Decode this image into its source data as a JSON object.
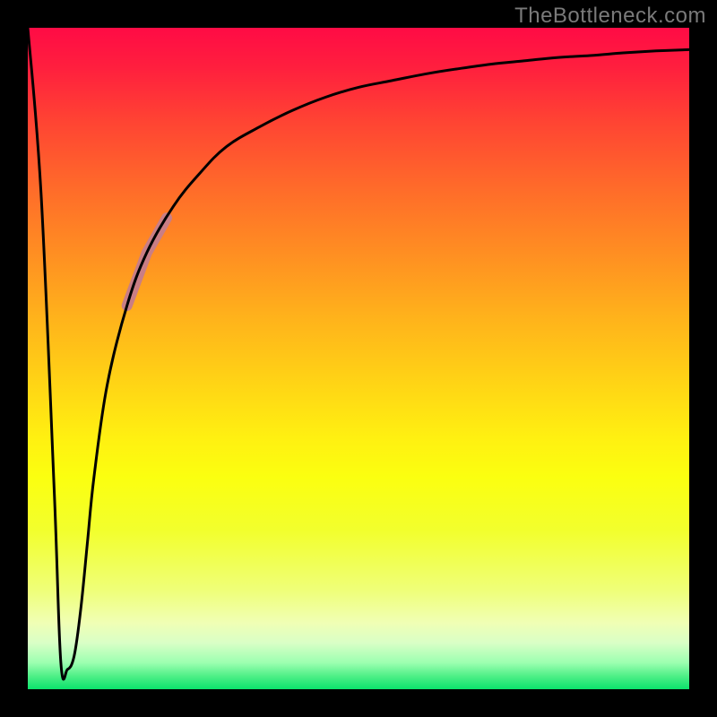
{
  "watermark": "TheBottleneck.com",
  "chart_data": {
    "type": "line",
    "title": "",
    "xlabel": "",
    "ylabel": "",
    "xlim": [
      0,
      100
    ],
    "ylim": [
      0,
      100
    ],
    "grid": false,
    "legend": false,
    "background_gradient": {
      "top_color": "#ff0b45",
      "bottom_color": "#0be36c",
      "meaning": "red high / green low"
    },
    "series": [
      {
        "name": "bottleneck-curve",
        "x": [
          0,
          2,
          4,
          5,
          6,
          7,
          8,
          9,
          10,
          12,
          15,
          18,
          22,
          26,
          30,
          35,
          40,
          45,
          50,
          55,
          60,
          65,
          70,
          75,
          80,
          85,
          90,
          95,
          100
        ],
        "y": [
          100,
          75,
          30,
          4,
          3,
          5,
          12,
          22,
          32,
          46,
          58,
          66,
          73,
          78,
          82,
          85,
          87.5,
          89.5,
          91,
          92,
          93,
          93.8,
          94.5,
          95,
          95.5,
          95.8,
          96.2,
          96.5,
          96.7
        ]
      }
    ],
    "highlight_segment": {
      "series": "bottleneck-curve",
      "x_start": 15,
      "x_end": 21,
      "color": "#c97e85"
    }
  }
}
